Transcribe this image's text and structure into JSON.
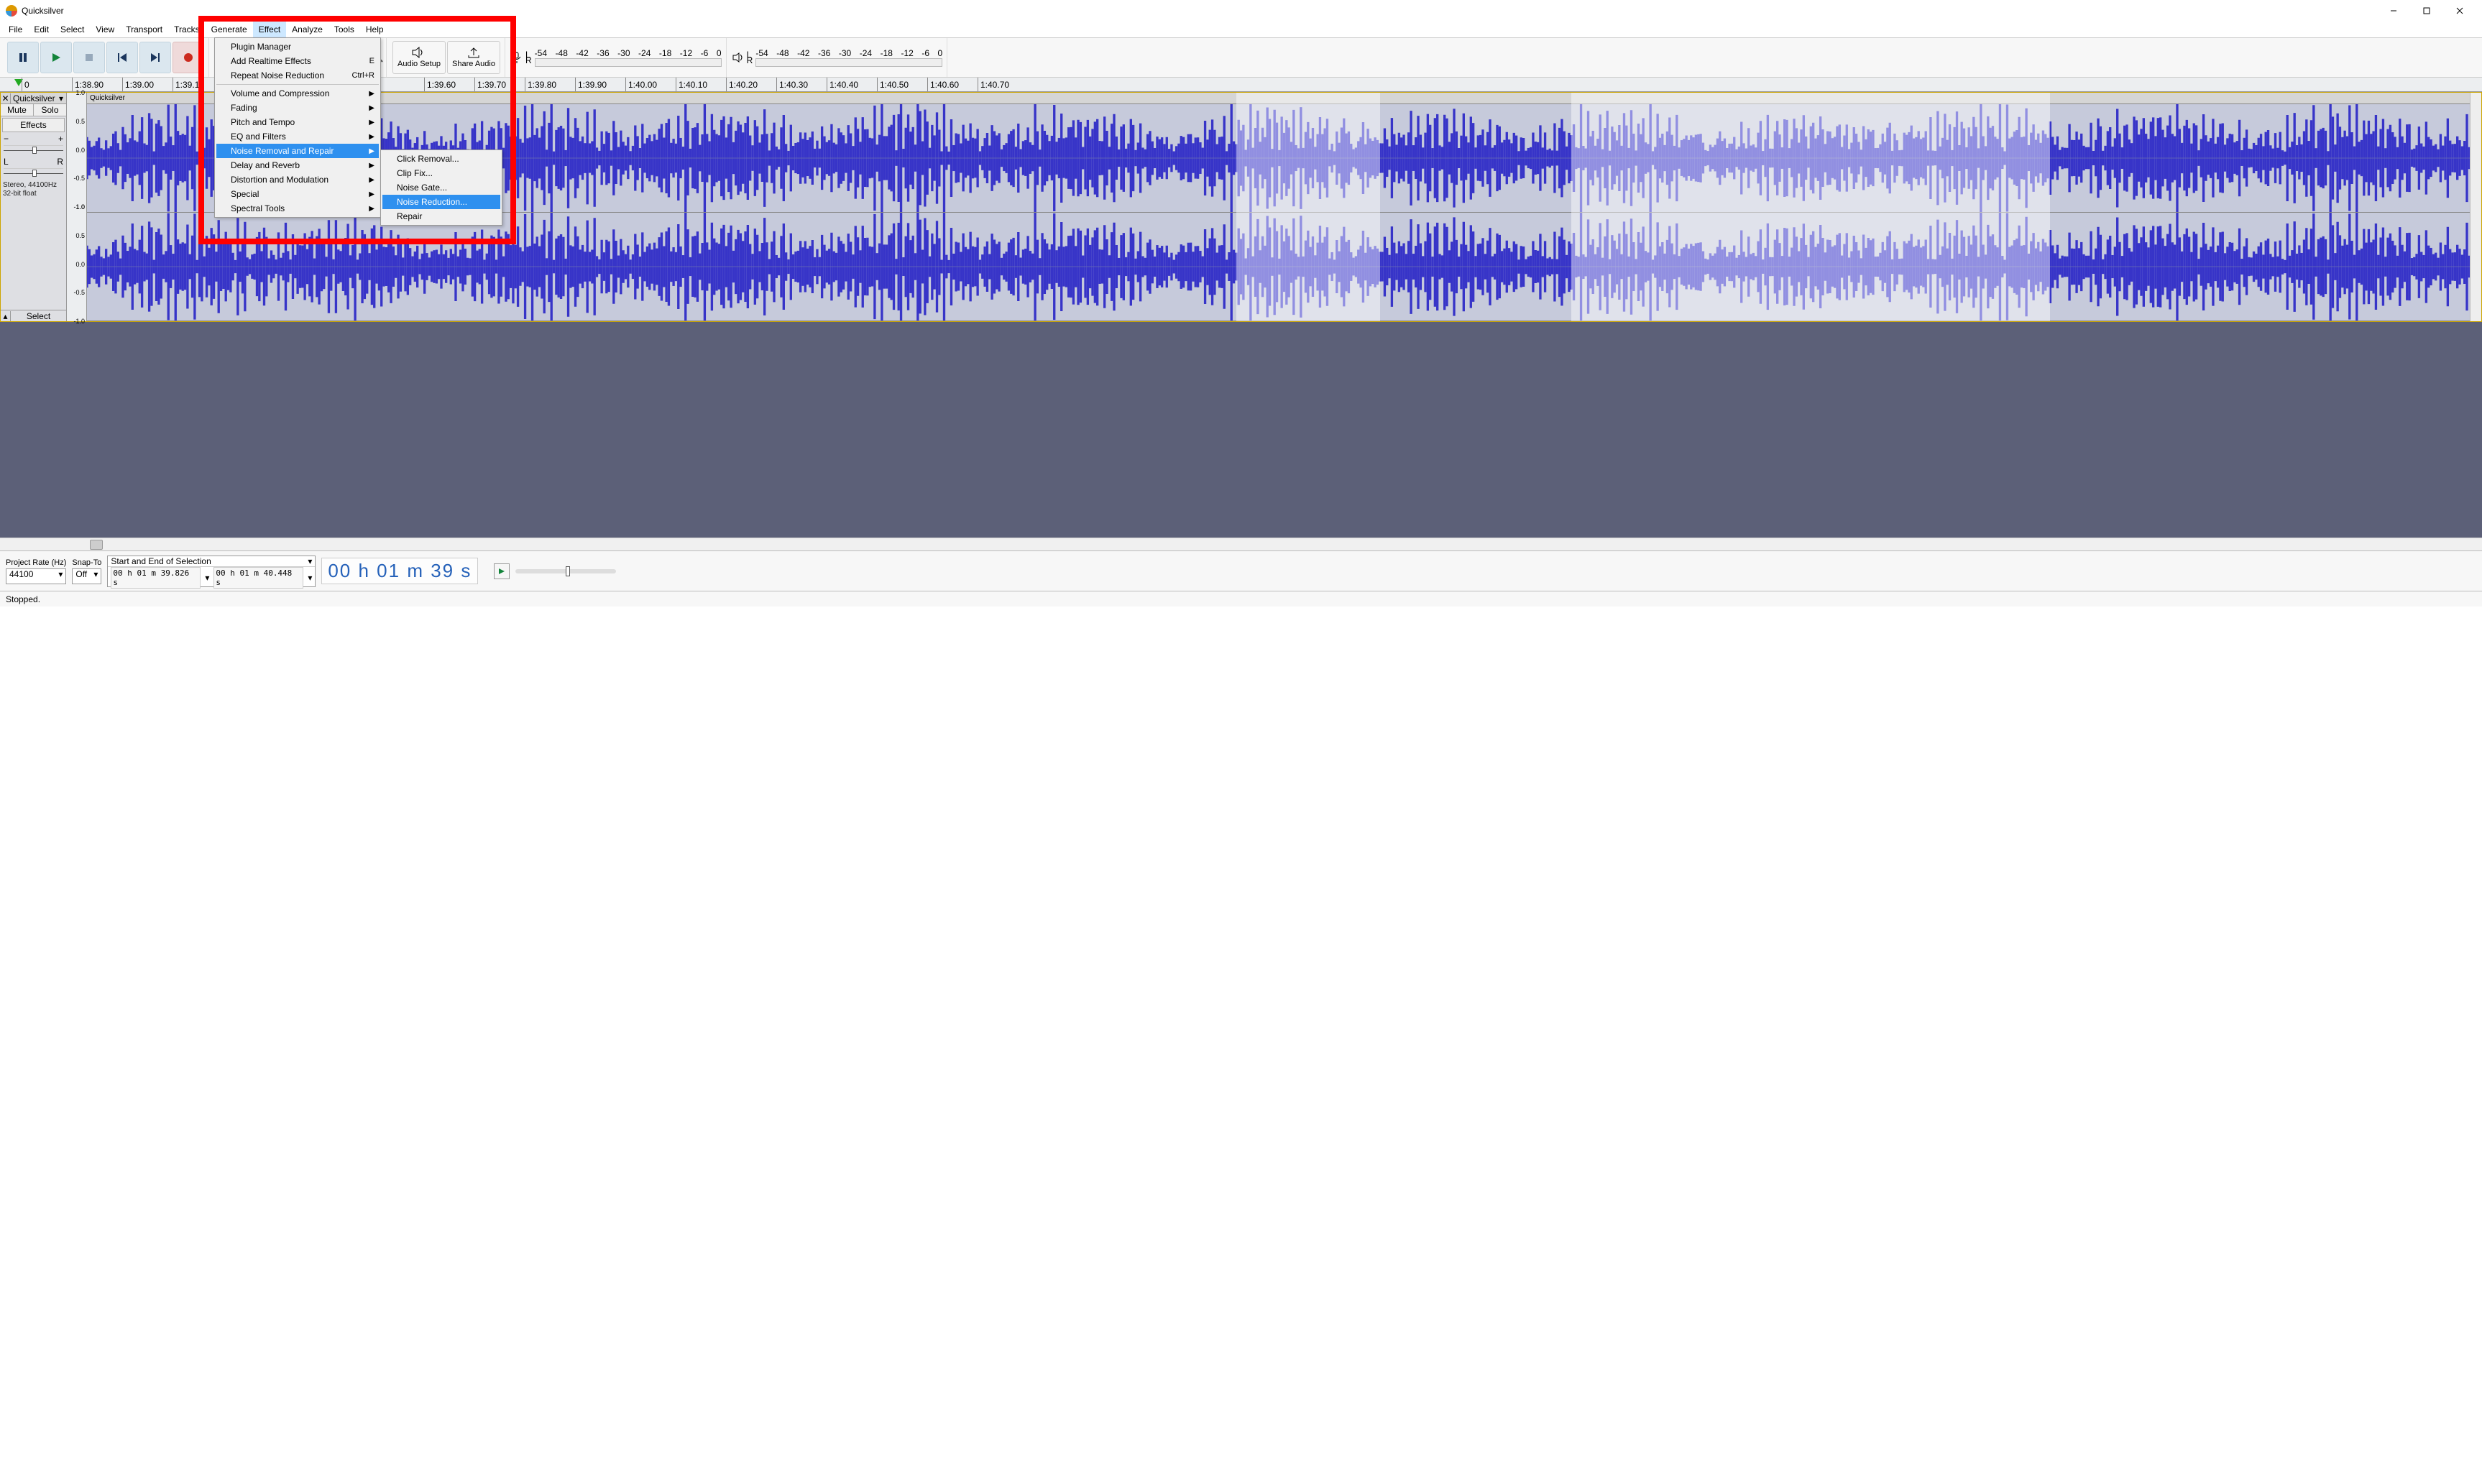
{
  "title": "Quicksilver",
  "menubar": [
    "File",
    "Edit",
    "Select",
    "View",
    "Transport",
    "Tracks",
    "Generate",
    "Effect",
    "Analyze",
    "Tools",
    "Help"
  ],
  "menubar_active_index": 7,
  "toolbar": {
    "audio_setup": "Audio Setup",
    "share_audio": "Share Audio"
  },
  "meter": {
    "labels": [
      "-54",
      "-48",
      "-42",
      "-36",
      "-30",
      "-24",
      "-18",
      "-12",
      "-6",
      "0"
    ],
    "L": "L",
    "R": "R"
  },
  "timeline": {
    "ticks": [
      "0",
      "1:38.90",
      "1:39.00",
      "1:39.10",
      "",
      "",
      "",
      "",
      "1:39.60",
      "1:39.70",
      "1:39.80",
      "1:39.90",
      "1:40.00",
      "1:40.10",
      "1:40.20",
      "1:40.30",
      "1:40.40",
      "1:40.50",
      "1:40.60",
      "1:40.70"
    ]
  },
  "track": {
    "name": "Quicksilver",
    "mute": "Mute",
    "solo": "Solo",
    "effects": "Effects",
    "L": "L",
    "R": "R",
    "info": "Stereo, 44100Hz\n32-bit float",
    "select": "Select",
    "clipname": "Quicksilver",
    "scale": [
      "1.0",
      "0.5",
      "0.0",
      "-0.5",
      "-1.0"
    ]
  },
  "effect_menu": {
    "items": [
      {
        "label": "Plugin Manager"
      },
      {
        "label": "Add Realtime Effects",
        "shortcut": "E"
      },
      {
        "label": "Repeat Noise Reduction",
        "shortcut": "Ctrl+R"
      },
      {
        "sep": true
      },
      {
        "label": "Volume and Compression",
        "sub": true
      },
      {
        "label": "Fading",
        "sub": true
      },
      {
        "label": "Pitch and Tempo",
        "sub": true
      },
      {
        "label": "EQ and Filters",
        "sub": true
      },
      {
        "label": "Noise Removal and Repair",
        "sub": true,
        "hi": true
      },
      {
        "label": "Delay and Reverb",
        "sub": true
      },
      {
        "label": "Distortion and Modulation",
        "sub": true
      },
      {
        "label": "Special",
        "sub": true
      },
      {
        "label": "Spectral Tools",
        "sub": true
      }
    ]
  },
  "submenu": {
    "items": [
      {
        "label": "Click Removal..."
      },
      {
        "label": "Clip Fix..."
      },
      {
        "label": "Noise Gate..."
      },
      {
        "label": "Noise Reduction...",
        "hi": true
      },
      {
        "label": "Repair"
      }
    ]
  },
  "bottom": {
    "project_rate_lbl": "Project Rate (Hz)",
    "project_rate": "44100",
    "snap_lbl": "Snap-To",
    "snap": "Off",
    "sel_lbl": "Start and End of Selection",
    "sel_start": "00 h 01 m 39.826 s",
    "sel_end": "00 h 01 m 40.448 s",
    "bigtime": "00 h 01 m 39 s"
  },
  "status": "Stopped."
}
